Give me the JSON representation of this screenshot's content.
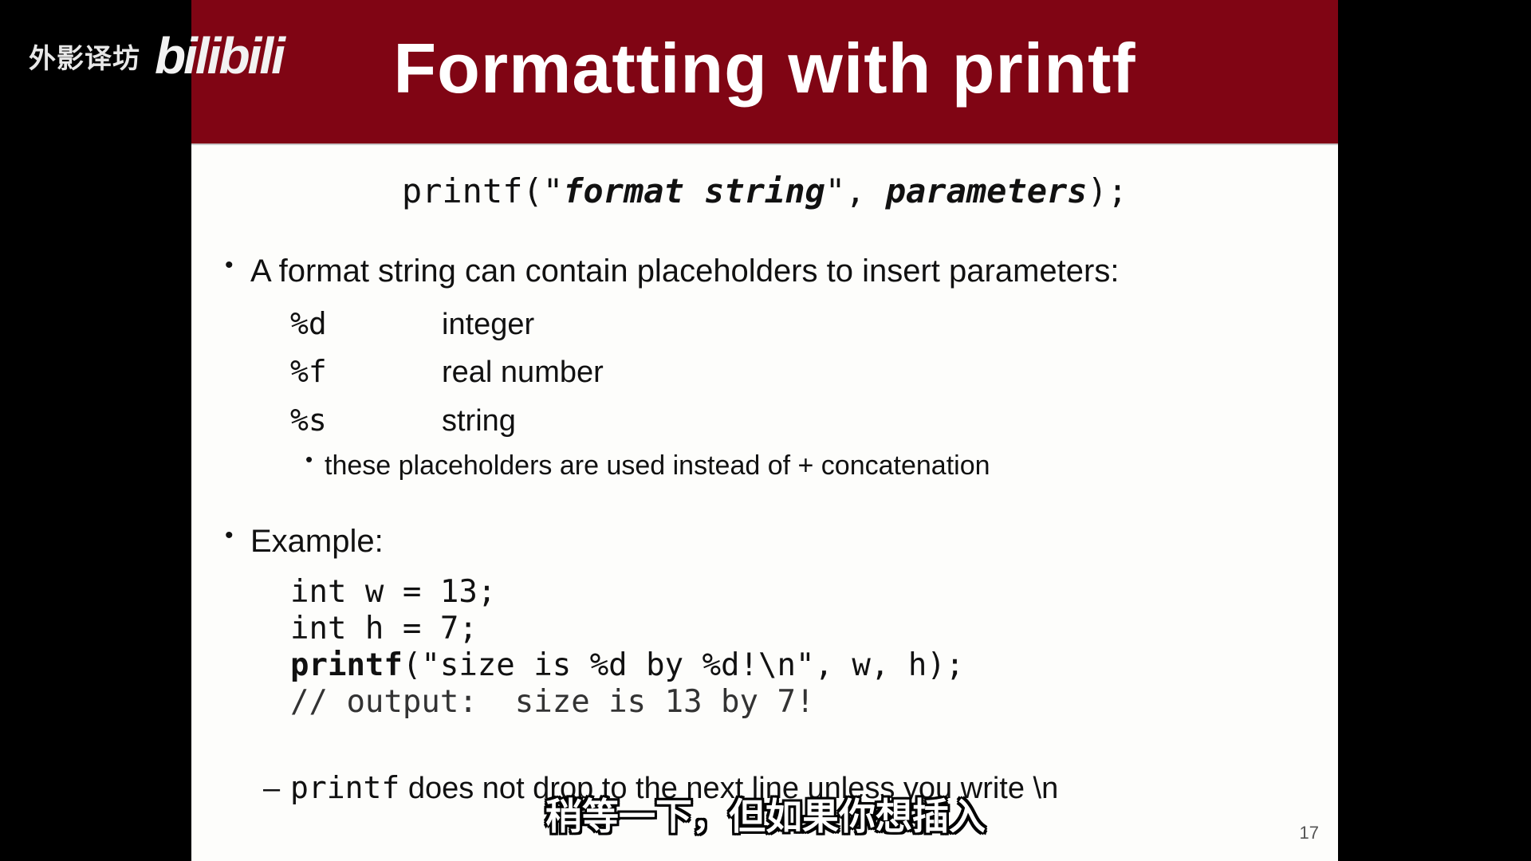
{
  "watermark": {
    "channel": "外影译坊",
    "logo": "bilibili"
  },
  "slide": {
    "title": "Formatting with printf",
    "syntax": {
      "prefix": "printf(\"",
      "format": "format string",
      "middle": "\", ",
      "params": "parameters",
      "suffix": ");"
    },
    "bullet1": "A format string can contain placeholders to insert parameters:",
    "placeholders": [
      {
        "code": "%d",
        "desc": "integer"
      },
      {
        "code": "%f",
        "desc": "real number"
      },
      {
        "code": "%s",
        "desc": "string"
      }
    ],
    "sub_bullet": "these placeholders are used instead of + concatenation",
    "bullet2": "Example:",
    "code_lines": {
      "l1": "int w = 13;",
      "l2": "int h = 7;",
      "l3_kw": "printf",
      "l3_rest": "(\"size is %d by %d!\\n\", w, h);",
      "l4": "// output:  size is 13 by 7!"
    },
    "note": {
      "dash": "–",
      "code": "printf",
      "text": " does not drop to the next line unless you write \\n"
    },
    "page_number": "17"
  },
  "subtitle": "稍等一下，但如果你想插入"
}
